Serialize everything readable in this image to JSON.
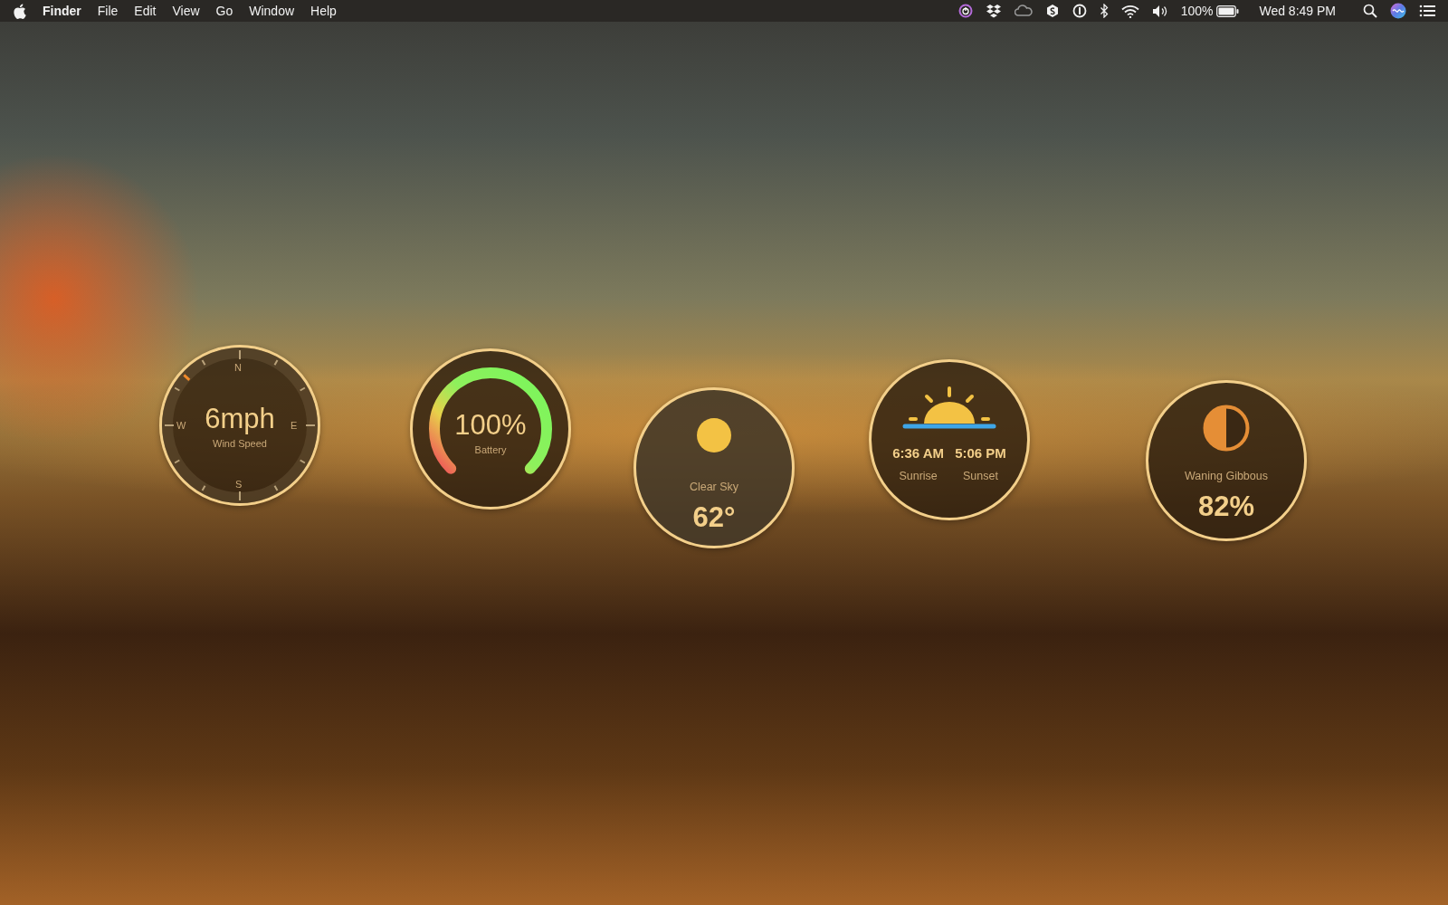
{
  "menu_bar": {
    "app_name": "Finder",
    "menus": [
      "File",
      "Edit",
      "View",
      "Go",
      "Window",
      "Help"
    ],
    "battery_percent": "100%",
    "clock": "Wed 8:49 PM"
  },
  "widgets": [
    {
      "kind": "wind",
      "value": "6mph",
      "label": "Wind Speed",
      "compass": [
        "N",
        "E",
        "S",
        "W"
      ]
    },
    {
      "kind": "battery",
      "value": "100%",
      "label": "Battery",
      "level": 1
    },
    {
      "kind": "weather",
      "condition": "Clear Sky",
      "temperature": "62°"
    },
    {
      "kind": "sun",
      "sunrise_time": "6:36 AM",
      "sunrise_label": "Sunrise",
      "sunset_time": "5:06 PM",
      "sunset_label": "Sunset"
    },
    {
      "kind": "moon",
      "phase": "Waning Gibbous",
      "value": "82%"
    }
  ]
}
